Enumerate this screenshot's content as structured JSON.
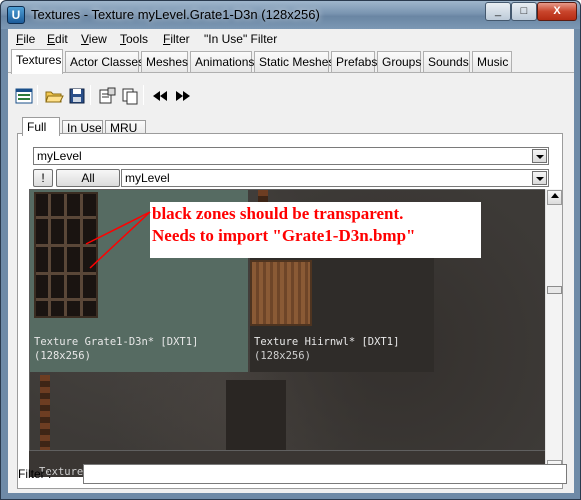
{
  "window": {
    "title": "Textures - Texture myLevel.Grate1-D3n (128x256)",
    "app_icon": "unreal-editor-icon",
    "controls": {
      "minimize": "_",
      "maximize": "□",
      "close": "X"
    }
  },
  "menu": [
    {
      "mnemonic": "F",
      "rest": "ile"
    },
    {
      "mnemonic": "E",
      "rest": "dit"
    },
    {
      "mnemonic": "V",
      "rest": "iew"
    },
    {
      "mnemonic": "T",
      "rest": "ools"
    },
    {
      "mnemonic": "F",
      "rest": "ilter"
    },
    {
      "mnemonic": "",
      "rest": "\"In Use\" Filter"
    }
  ],
  "browser_tabs": [
    "Textures",
    "Actor Classes",
    "Meshes",
    "Animations",
    "Static Meshes",
    "Prefabs",
    "Groups",
    "Sounds",
    "Music"
  ],
  "toolbar": {
    "icons": [
      "browser-dock-icon",
      "open-folder-icon",
      "save-icon",
      "properties-icon",
      "duplicate-icon",
      "previous-icon",
      "next-icon"
    ]
  },
  "view_tabs": [
    "Full",
    "In Use",
    "MRU"
  ],
  "package_combo": {
    "value": "myLevel"
  },
  "group_row": {
    "bang_label": "!",
    "all_label": "All",
    "group_value": "myLevel"
  },
  "textures": [
    {
      "label": "Texture Grate1-D3n* [DXT1]",
      "size": "(128x256)",
      "selected": true
    },
    {
      "label": "Texture Hiirnwl* [DXT1]",
      "size": "(128x256)",
      "selected": false
    }
  ],
  "cut_off_row": "Texture ...  Texture ...",
  "annotation": {
    "line1": "black zones should be transparent.",
    "line2": "Needs to import \"Grate1-D3n.bmp\"",
    "color": "#ff0000"
  },
  "filter": {
    "label": "Filter :",
    "value": ""
  },
  "colors": {
    "title_bar": "#7994b0",
    "selected_tile": "#566b62",
    "viewer_bg": "#3d3a37"
  }
}
